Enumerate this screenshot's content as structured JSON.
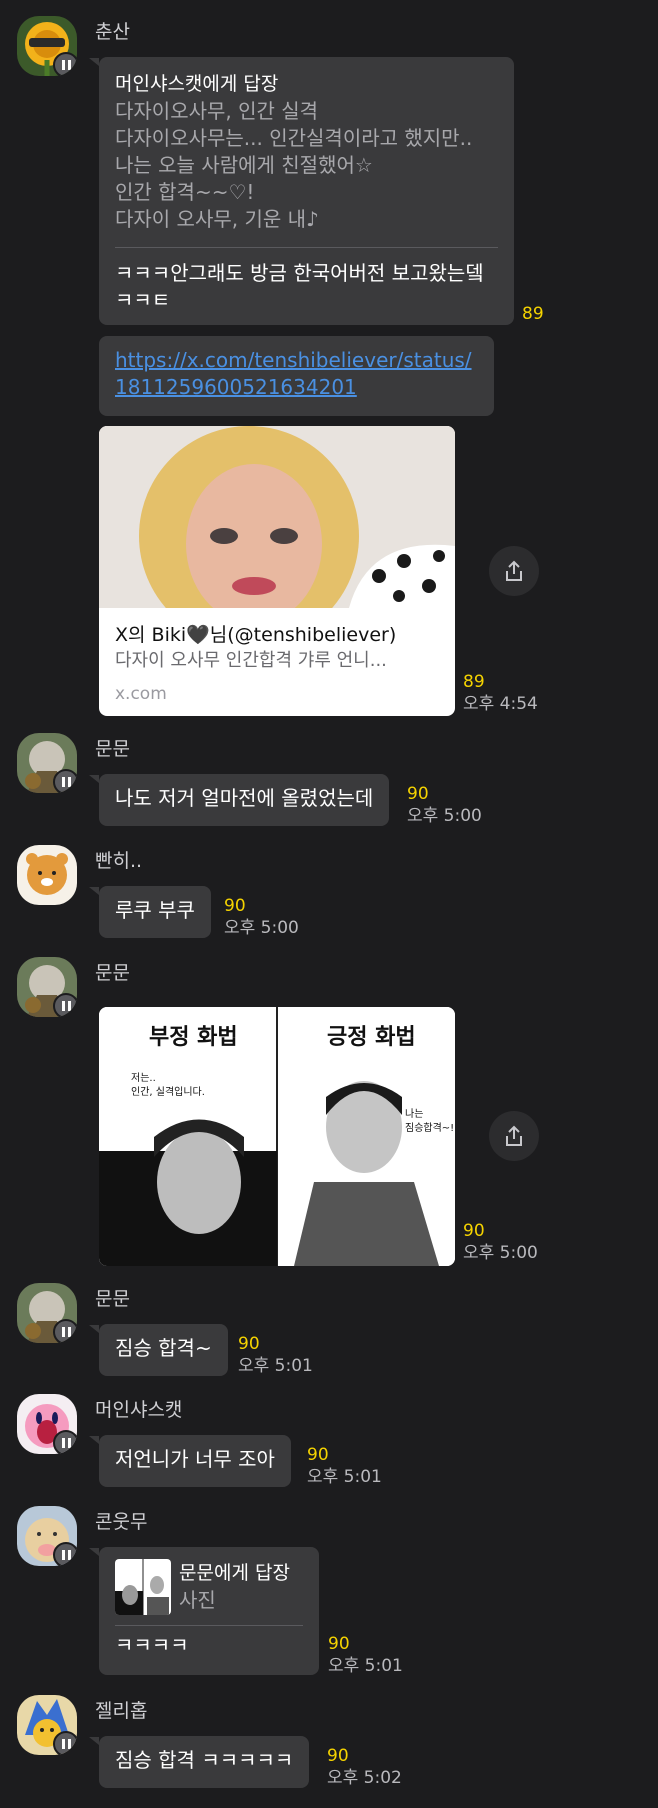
{
  "messages": [
    {
      "name": "춘산",
      "reply": {
        "title": "머인샤스캣에게 답장",
        "quoted": [
          "다자이오사무, 인간 실격",
          "다자이오사무는... 인간실격이라고 했지만..",
          "나는 오늘 사람에게 친절했어☆",
          "인간 합격~~♡!",
          "다자이 오사무, 기운 내♪"
        ],
        "text": [
          "ㅋㅋㅋ안그래도 방금 한국어버전 보고왔는뎈",
          "ㅋㅋㅌ"
        ],
        "count": "89"
      },
      "link": [
        "https://x.com/tenshibeliever/status/",
        "1811259600521634201"
      ],
      "card": {
        "title": "X의 Biki🖤님(@tenshibeliever)",
        "desc": "다자이 오사무 인간합격 갸루 언니...",
        "domain": "x.com",
        "count": "89",
        "time": "오후 4:54"
      }
    },
    {
      "name": "문문",
      "text": "나도 저거 얼마전에 올렸었는데",
      "count": "90",
      "time": "오후 5:00"
    },
    {
      "name": "빤히..",
      "text": "루쿠 부쿠",
      "count": "90",
      "time": "오후 5:00"
    },
    {
      "name": "문문",
      "photo": {
        "left_title": "부정 화법",
        "left_caption": [
          "저는..",
          "인간, 실격입니다."
        ],
        "right_title": "긍정 화법",
        "right_caption": [
          "나는",
          "짐승합격~!"
        ]
      },
      "count": "90",
      "time": "오후 5:00"
    },
    {
      "name": "문문",
      "text": "짐승 합격~",
      "count": "90",
      "time": "오후 5:01"
    },
    {
      "name": "머인샤스캣",
      "text": "저언니가 너무 조아",
      "count": "90",
      "time": "오후 5:01"
    },
    {
      "name": "콘웃무",
      "reply": {
        "title": "문문에게 답장",
        "subtitle": "사진",
        "text": "ㅋㅋㅋㅋ"
      },
      "count": "90",
      "time": "오후 5:01"
    },
    {
      "name": "젤리홉",
      "text": "짐승 합격 ㅋㅋㅋㅋㅋ",
      "count": "90",
      "time": "오후 5:02"
    }
  ],
  "colors": {
    "background": "#1c1c1e",
    "bubble": "#3a3a3c",
    "count": "#f5d300",
    "link": "#4a90e2"
  },
  "icons": {
    "share": "share-icon",
    "badge": "profile-badge-icon"
  }
}
